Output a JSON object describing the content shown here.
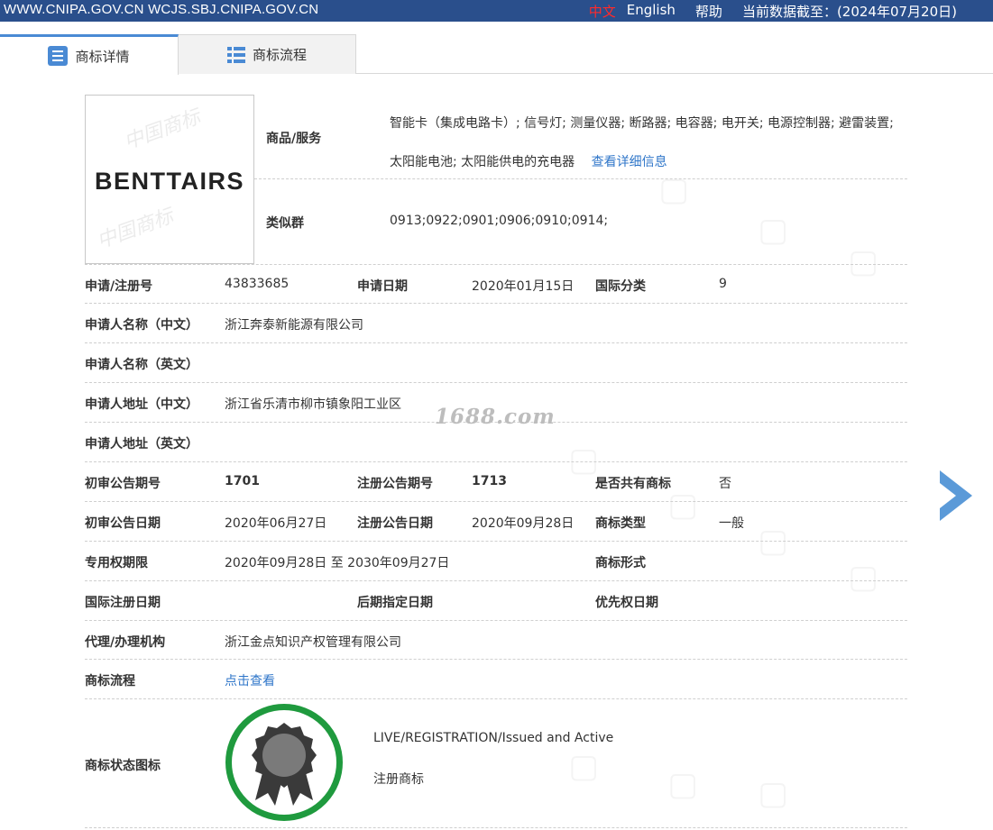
{
  "topbar": {
    "domains": "WWW.CNIPA.GOV.CN WCJS.SBJ.CNIPA.GOV.CN",
    "lang_cn": "中文",
    "lang_en": "English",
    "help": "帮助",
    "data_date": "当前数据截至：(2024年07月20日)"
  },
  "tabs": [
    {
      "label": "商标详情",
      "icon": "detail-icon"
    },
    {
      "label": "商标流程",
      "icon": "list-icon"
    }
  ],
  "logo": {
    "text": "BENTTAIRS",
    "watermark": "中国商标"
  },
  "goods": {
    "label": "商品/服务",
    "value": "智能卡（集成电路卡）; 信号灯; 测量仪器; 断路器; 电容器; 电开关; 电源控制器; 避雷装置; 太阳能电池; 太阳能供电的充电器",
    "link": "查看详细信息"
  },
  "similar": {
    "label": "类似群",
    "value": "0913;0922;0901;0906;0910;0914;"
  },
  "fields": {
    "reg_no_label": "申请/注册号",
    "reg_no": "43833685",
    "app_date_label": "申请日期",
    "app_date": "2020年01月15日",
    "intl_class_label": "国际分类",
    "intl_class": "9",
    "applicant_cn_label": "申请人名称（中文）",
    "applicant_cn": "浙江奔泰新能源有限公司",
    "applicant_en_label": "申请人名称（英文）",
    "address_cn_label": "申请人地址（中文）",
    "address_cn": "浙江省乐清市柳市镇象阳工业区",
    "address_en_label": "申请人地址（英文）",
    "prelim_no_label": "初审公告期号",
    "prelim_no": "1701",
    "reg_pub_no_label": "注册公告期号",
    "reg_pub_no": "1713",
    "shared_label": "是否共有商标",
    "shared": "否",
    "prelim_date_label": "初审公告日期",
    "prelim_date": "2020年06月27日",
    "reg_pub_date_label": "注册公告日期",
    "reg_pub_date": "2020年09月28日",
    "type_label": "商标类型",
    "type": "一般",
    "term_label": "专用权期限",
    "term": "2020年09月28日 至 2030年09月27日",
    "form_label": "商标形式",
    "intl_reg_date_label": "国际注册日期",
    "later_date_label": "后期指定日期",
    "priority_label": "优先权日期",
    "agent_label": "代理/办理机构",
    "agent": "浙江金点知识产权管理有限公司",
    "flow_label": "商标流程",
    "flow_link": "点击查看",
    "status_label": "商标状态图标",
    "status_en": "LIVE/REGISTRATION/Issued and Active",
    "status_cn": "注册商标"
  },
  "watermark_1688": "1688.com",
  "colors": {
    "topbar": "#2a4f8c",
    "accent": "#4a8ad4",
    "link": "#2f76c9",
    "badge_ring": "#1f9a3e",
    "lang_cn": "#ff2a2a"
  }
}
